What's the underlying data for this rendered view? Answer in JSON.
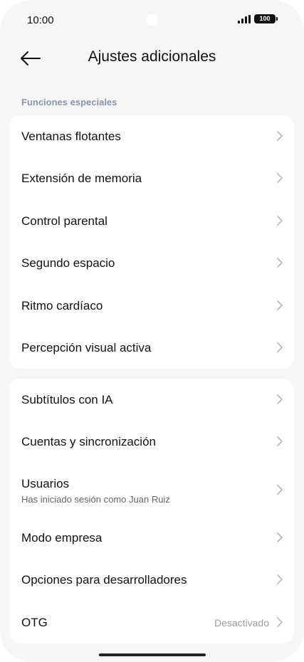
{
  "status_bar": {
    "time": "10:00",
    "battery": "100"
  },
  "header": {
    "title": "Ajustes adicionales"
  },
  "section": {
    "label": "Funciones especiales"
  },
  "group1": [
    {
      "title": "Ventanas flotantes"
    },
    {
      "title": "Extensión de memoria"
    },
    {
      "title": "Control parental"
    },
    {
      "title": "Segundo espacio"
    },
    {
      "title": "Ritmo cardíaco"
    },
    {
      "title": "Percepción visual activa"
    }
  ],
  "group2": [
    {
      "title": "Subtítulos con IA"
    },
    {
      "title": "Cuentas y sincronización"
    },
    {
      "title": "Usuarios",
      "subtitle": "Has iniciado sesión como Juan Ruiz"
    },
    {
      "title": "Modo empresa"
    },
    {
      "title": "Opciones para desarrolladores"
    },
    {
      "title": "OTG",
      "value": "Desactivado"
    }
  ],
  "icons": {
    "back": "arrow-left-icon",
    "chevron": "chevron-right-icon",
    "signal": "signal-icon",
    "battery": "battery-icon"
  }
}
